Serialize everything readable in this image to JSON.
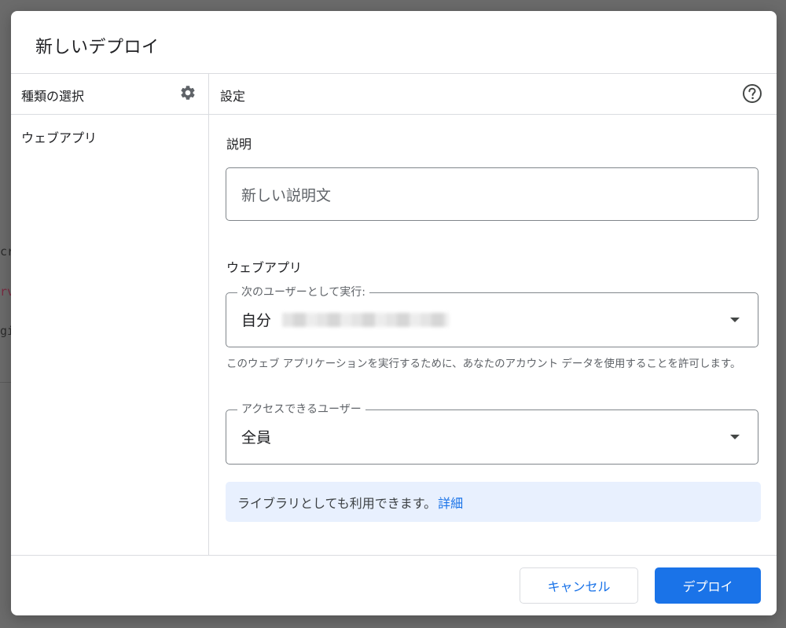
{
  "background": {
    "code_fragments": [
      "cr",
      "rv",
      "gi"
    ]
  },
  "dialog": {
    "title": "新しいデプロイ",
    "left_panel": {
      "header": "種類の選択",
      "items": [
        "ウェブアプリ"
      ]
    },
    "right_panel": {
      "header": "設定",
      "description": {
        "label": "説明",
        "placeholder": "新しい説明文"
      },
      "web_app": {
        "section_label": "ウェブアプリ",
        "execute_as": {
          "legend": "次のユーザーとして実行:",
          "value": "自分"
        },
        "help_text": "このウェブ アプリケーションを実行するために、あなたのアカウント データを使用することを許可します。",
        "access": {
          "legend": "アクセスできるユーザー",
          "value": "全員"
        }
      },
      "info": {
        "text": "ライブラリとしても利用できます。",
        "link": "詳細"
      }
    },
    "footer": {
      "cancel_label": "キャンセル",
      "deploy_label": "デプロイ"
    }
  },
  "icons": {
    "settings": "gear-icon",
    "help": "help-circle-icon",
    "dropdown": "caret-down-icon"
  },
  "colors": {
    "accent": "#1a73e8",
    "info_background": "#e8f0fe",
    "overlay": "#6b6b6b"
  }
}
